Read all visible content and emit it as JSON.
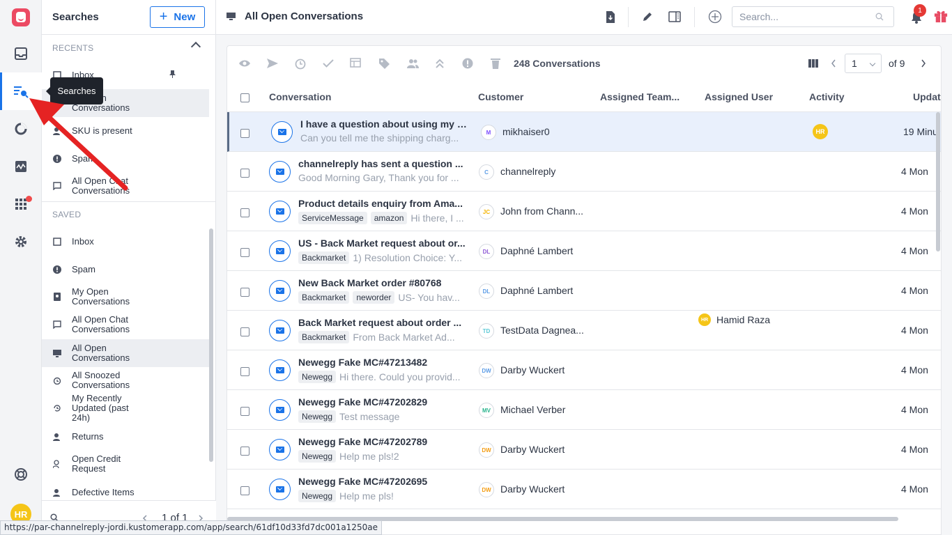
{
  "rail": {
    "avatar_initials": "HR",
    "icons": [
      "logo-icon",
      "inbox-icon",
      "searches-icon",
      "reporting-icon",
      "activity-icon",
      "apps-icon",
      "settings-icon",
      "help-icon"
    ]
  },
  "tooltip": "Searches",
  "panel": {
    "title": "Searches",
    "new_label": "New",
    "recents_label": "RECENTS",
    "saved_label": "SAVED",
    "recents": [
      {
        "label": "Inbox",
        "icon": "inbox-icon"
      },
      {
        "label": "All Open Conversations",
        "icon": "monitor-icon"
      },
      {
        "label": "SKU is present",
        "icon": "user-search-icon"
      },
      {
        "label": "Spam",
        "icon": "alert-icon"
      },
      {
        "label": "All Open Chat Conversations",
        "icon": "chat-icon"
      }
    ],
    "saved": [
      {
        "label": "Inbox",
        "icon": "inbox-icon"
      },
      {
        "label": "Spam",
        "icon": "alert-icon"
      },
      {
        "label": "My Open Conversations",
        "icon": "contact-icon"
      },
      {
        "label": "All Open Chat Conversations",
        "icon": "chat-icon"
      },
      {
        "label": "All Open Conversations",
        "icon": "monitor-icon"
      },
      {
        "label": "All Snoozed Conversations",
        "icon": "alarm-icon"
      },
      {
        "label": "My Recently Updated (past 24h)",
        "icon": "history-icon"
      },
      {
        "label": "Returns",
        "icon": "user-search-icon"
      },
      {
        "label": "Open Credit Request",
        "icon": "user-edit-icon"
      },
      {
        "label": "Defective Items",
        "icon": "user-search-icon"
      }
    ],
    "pager": "1 of 1"
  },
  "topbar": {
    "title": "All Open Conversations",
    "search_placeholder": "Search...",
    "notification_count": "1"
  },
  "toolbar": {
    "count_label": "248 Conversations",
    "page_value": "1",
    "of_pages": "of 9"
  },
  "table": {
    "headers": {
      "conversation": "Conversation",
      "customer": "Customer",
      "team": "Assigned Team...",
      "user": "Assigned User",
      "activity": "Activity",
      "updated": "Updat"
    },
    "rows": [
      {
        "subject": "I have a question about using my it...",
        "tags": [],
        "preview": "Can you tell me the shipping charg...",
        "cust_initials": "M",
        "cust_color": "#7c4dff",
        "customer": "mikhaiser0",
        "assigned_user": "",
        "activity": "HR",
        "updated": "19 Minu"
      },
      {
        "subject": "channelreply has sent a question ...",
        "tags": [],
        "preview": "Good Morning Gary, Thank you for ...",
        "cust_initials": "C",
        "cust_color": "#5c9ce6",
        "customer": "channelreply",
        "assigned_user": "",
        "activity": "",
        "updated": "4 Mon"
      },
      {
        "subject": "Product details enquiry from Ama...",
        "tags": [
          "ServiceMessage",
          "amazon"
        ],
        "preview": "Hi there, I ...",
        "cust_initials": "JC",
        "cust_color": "#f5b400",
        "customer": "John from Chann...",
        "assigned_user": "",
        "activity": "",
        "updated": "4 Mon"
      },
      {
        "subject": "US - Back Market request about or...",
        "tags": [
          "Backmarket"
        ],
        "preview": "1) Resolution Choice: Y...",
        "cust_initials": "DL",
        "cust_color": "#8e5bd6",
        "customer": "Daphné Lambert",
        "assigned_user": "",
        "activity": "",
        "updated": "4 Mon"
      },
      {
        "subject": "New Back Market order #80768",
        "tags": [
          "Backmarket",
          "neworder"
        ],
        "preview": "US- You hav...",
        "cust_initials": "DL",
        "cust_color": "#5c9ce6",
        "customer": "Daphné Lambert",
        "assigned_user": "",
        "activity": "",
        "updated": "4 Mon"
      },
      {
        "subject": "Back Market request about order ...",
        "tags": [
          "Backmarket"
        ],
        "preview": "From Back Market Ad...",
        "cust_initials": "TD",
        "cust_color": "#5bc8d6",
        "customer": "TestData Dagnea...",
        "assigned_user": "Hamid Raza",
        "activity": "",
        "updated": "4 Mon"
      },
      {
        "subject": "Newegg Fake MC#47213482",
        "tags": [
          "Newegg"
        ],
        "preview": "Hi there. Could you provid...",
        "cust_initials": "DW",
        "cust_color": "#5c9ce6",
        "customer": "Darby Wuckert",
        "assigned_user": "",
        "activity": "",
        "updated": "4 Mon"
      },
      {
        "subject": "Newegg Fake MC#47202829",
        "tags": [
          "Newegg"
        ],
        "preview": "Test message",
        "cust_initials": "MV",
        "cust_color": "#27b38c",
        "customer": "Michael Verber",
        "assigned_user": "",
        "activity": "",
        "updated": "4 Mon"
      },
      {
        "subject": "Newegg Fake MC#47202789",
        "tags": [
          "Newegg"
        ],
        "preview": "Help me pls!2",
        "cust_initials": "DW",
        "cust_color": "#f39c12",
        "customer": "Darby Wuckert",
        "assigned_user": "",
        "activity": "",
        "updated": "4 Mon"
      },
      {
        "subject": "Newegg Fake MC#47202695",
        "tags": [
          "Newegg"
        ],
        "preview": "Help me pls!",
        "cust_initials": "DW",
        "cust_color": "#f39c12",
        "customer": "Darby Wuckert",
        "assigned_user": "",
        "activity": "",
        "updated": "4 Mon"
      }
    ]
  },
  "status_url": "https://par-channelreply-jordi.kustomerapp.com/app/search/61df10d33fd7dc001a1250ae",
  "colors": {
    "accent": "#1a73e8",
    "brand": "#ec4a63",
    "arrow": "#e52323"
  }
}
